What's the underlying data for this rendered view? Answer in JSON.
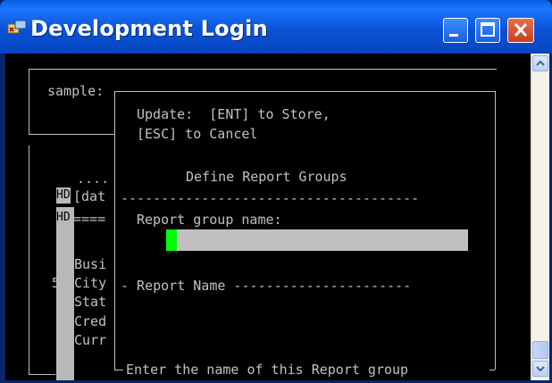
{
  "window": {
    "title": "Development Login",
    "icon": "terminal-app-icon",
    "controls": [
      "minimize-icon",
      "maximize-icon",
      "close-icon"
    ]
  },
  "background_screen": {
    "sample_label": "sample:",
    "dots": "....",
    "hd_1": "HD",
    "hd_2": "HD",
    "dat_text": "[dat",
    "equals_text": "====",
    "list": [
      "Busi",
      "City",
      "Stat",
      "Cred",
      "Curr"
    ],
    "number_5": "5"
  },
  "dialog": {
    "line1": "Update:  [ENT] to Store,",
    "line2": "[ESC] to Cancel",
    "heading": "Define Report Groups",
    "separator": "-------------------------------------",
    "field_label": "Report group name:",
    "field_value": "",
    "report_name_line": "- Report Name ----------------------",
    "footer_hint": "Enter the name of this Report group"
  },
  "colors": {
    "terminal_bg": "#000000",
    "terminal_text": "#c0c0c0",
    "cursor": "#00ff00",
    "titlebar": "#0a53d6"
  }
}
